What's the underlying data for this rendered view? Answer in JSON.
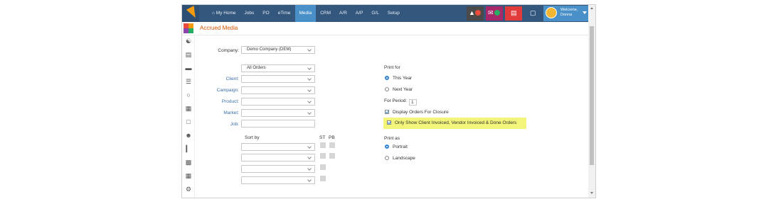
{
  "nav": {
    "items": [
      {
        "label": "My Home",
        "icon": "home-icon"
      },
      {
        "label": "Jobs"
      },
      {
        "label": "PO"
      },
      {
        "label": "eTime"
      },
      {
        "label": "Media",
        "active": true
      },
      {
        "label": "CRM"
      },
      {
        "label": "A/R"
      },
      {
        "label": "A/P"
      },
      {
        "label": "G/L"
      },
      {
        "label": "Setup"
      }
    ],
    "notifications": [
      {
        "icon": "bell-icon",
        "bg": "#4a4a4a",
        "badge_color": "#e74c3c"
      },
      {
        "icon": "mail-icon",
        "bg": "#a8266a",
        "badge_color": "#27ae60"
      },
      {
        "icon": "database-icon",
        "bg": "#e23b3b"
      },
      {
        "icon": "book-icon",
        "bg": "#34577e"
      }
    ],
    "welcome_line1": "Welcome,",
    "welcome_line2": "Donna"
  },
  "page": {
    "title": "Accrued Media"
  },
  "colors": {
    "nav_bg": "#34577e",
    "nav_active": "#4a90c8",
    "title": "#d35400",
    "link_label": "#3a6ea5",
    "highlight": "#f2f57a",
    "radio_on": "#2f80d1"
  },
  "sidebar_icons": [
    "org-chart-icon",
    "document-icon",
    "folder-icon",
    "list-icon",
    "chat-icon",
    "map-icon",
    "calendar-icon",
    "users-icon",
    "bar-chart-icon",
    "money-icon",
    "calendar-grid-icon",
    "settings-icon"
  ],
  "form": {
    "company_label": "Company:",
    "company_value": "Demo Company (DEM)",
    "orders_value": "All Orders",
    "client_label": "Client:",
    "campaign_label": "Campaign:",
    "product_label": "Product:",
    "market_label": "Market:",
    "job_label": "Job:",
    "sort_by_label": "Sort by",
    "st_label": "ST",
    "pb_label": "PB"
  },
  "print_for": {
    "label": "Print for",
    "this_year": "This Year",
    "next_year": "Next Year",
    "selected": "This Year",
    "period_label": "For Period:",
    "period_value": "1",
    "display_closure": "Display Orders For Closure",
    "display_closure_checked": true,
    "only_show": "Only Show Client Invoiced, Vendor Invoiced & Done Orders",
    "only_show_checked": true
  },
  "print_as": {
    "label": "Print as",
    "portrait": "Portrait",
    "landscape": "Landscape",
    "selected": "Portrait"
  }
}
